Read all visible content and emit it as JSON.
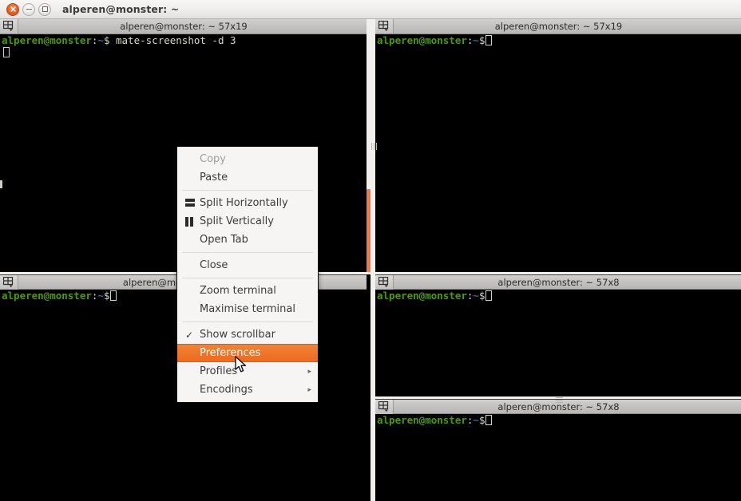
{
  "window": {
    "title": "alperen@monster: ~",
    "buttons": {
      "close": "×",
      "minimize": "minimize",
      "maximize": "maximize"
    }
  },
  "panes": [
    {
      "id": "pane-top-left",
      "title": "alperen@monster: ~ 57x19",
      "prompt_user": "alperen@monster",
      "prompt_colon": ":",
      "prompt_path": "~",
      "prompt_sigil": "$",
      "command": " mate-screenshot -d 3",
      "has_second_line_cursor": true
    },
    {
      "id": "pane-top-right",
      "title": "alperen@monster: ~ 57x19",
      "prompt_user": "alperen@monster",
      "prompt_colon": ":",
      "prompt_path": "~",
      "prompt_sigil": "$",
      "command": "",
      "has_second_line_cursor": false
    },
    {
      "id": "pane-bottom-left",
      "title": "alperen@monster: ~ 57x8",
      "prompt_user": "alperen@monster",
      "prompt_colon": ":",
      "prompt_path": "~",
      "prompt_sigil": "$",
      "command": "",
      "has_second_line_cursor": false
    },
    {
      "id": "pane-right-middle",
      "title": "alperen@monster: ~ 57x8",
      "prompt_user": "alperen@monster",
      "prompt_colon": ":",
      "prompt_path": "~",
      "prompt_sigil": "$",
      "command": "",
      "has_second_line_cursor": false
    },
    {
      "id": "pane-right-bottom",
      "title": "alperen@monster: ~ 57x8",
      "prompt_user": "alperen@monster",
      "prompt_colon": ":",
      "prompt_path": "~",
      "prompt_sigil": "$",
      "command": "",
      "has_second_line_cursor": false
    }
  ],
  "context_menu": {
    "items": [
      {
        "label": "Copy",
        "icon": "none",
        "state": "disabled",
        "arrow": ""
      },
      {
        "label": "Paste",
        "icon": "none",
        "state": "normal",
        "arrow": ""
      },
      {
        "label": "__separator__",
        "icon": "none",
        "state": "separator",
        "arrow": ""
      },
      {
        "label": "Split Horizontally",
        "icon": "split-horizontal-icon",
        "state": "normal",
        "arrow": ""
      },
      {
        "label": "Split Vertically",
        "icon": "split-vertical-icon",
        "state": "normal",
        "arrow": ""
      },
      {
        "label": "Open Tab",
        "icon": "none",
        "state": "normal",
        "arrow": ""
      },
      {
        "label": "__separator__",
        "icon": "none",
        "state": "separator",
        "arrow": ""
      },
      {
        "label": "Close",
        "icon": "none",
        "state": "normal",
        "arrow": ""
      },
      {
        "label": "__separator__",
        "icon": "none",
        "state": "separator",
        "arrow": ""
      },
      {
        "label": "Zoom terminal",
        "icon": "none",
        "state": "normal",
        "arrow": ""
      },
      {
        "label": "Maximise terminal",
        "icon": "none",
        "state": "normal",
        "arrow": ""
      },
      {
        "label": "__separator__",
        "icon": "none",
        "state": "separator",
        "arrow": ""
      },
      {
        "label": "Show scrollbar",
        "icon": "check-icon",
        "state": "checked",
        "arrow": ""
      },
      {
        "label": "Preferences",
        "icon": "none",
        "state": "selected",
        "arrow": ""
      },
      {
        "label": "Profiles",
        "icon": "none",
        "state": "normal",
        "arrow": "▸"
      },
      {
        "label": "Encodings",
        "icon": "none",
        "state": "normal",
        "arrow": "▸"
      }
    ]
  },
  "colors": {
    "accent_orange": "#ec6a21",
    "scrollbar_thumb": "#f0754a",
    "terminal_bg": "#000000",
    "prompt_green": "#4e9a06",
    "prompt_blue": "#3465a4",
    "titlebar_bg": "#efedec",
    "pane_header_bg": "#c4c2c0"
  }
}
